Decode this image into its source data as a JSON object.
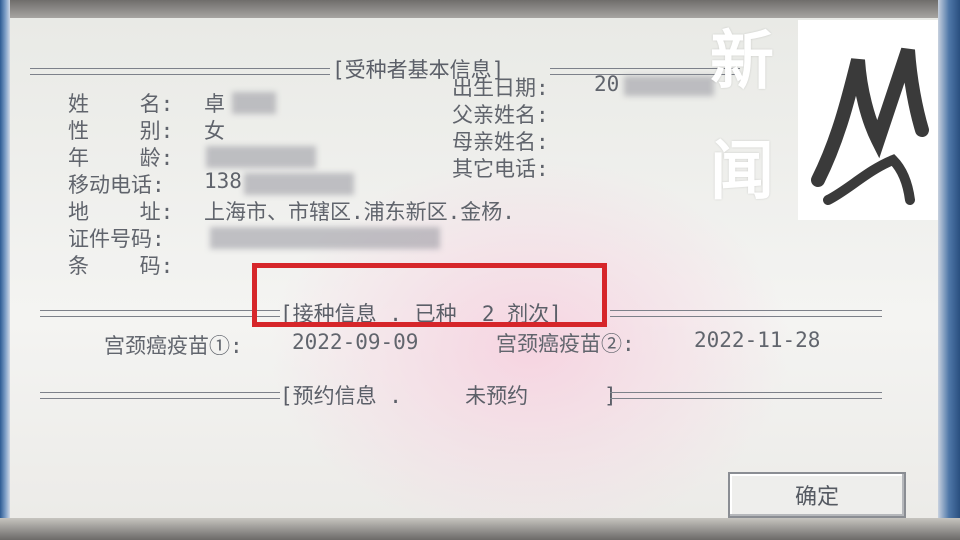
{
  "photo_frame": {
    "bezel_color": "#2c5b94"
  },
  "basic_info": {
    "header": "[受种者基本信息]",
    "name_label": "姓    名:",
    "name_value": "卓",
    "gender_label": "性    别:",
    "gender_value": "女",
    "age_label": "年    龄:",
    "age_value": "",
    "mobile_label": "移动电话:",
    "mobile_value": "138",
    "address_label": "地    址:",
    "address_value": "上海市、市辖区.浦东新区.金杨.",
    "id_label": "证件号码:",
    "id_value": "",
    "barcode_label": "条    码:",
    "barcode_value": "",
    "birth_label": "出生日期:",
    "birth_value": "20",
    "father_label": "父亲姓名:",
    "father_value": "",
    "mother_label": "母亲姓名:",
    "mother_value": "",
    "other_phone_label": "其它电话:",
    "other_phone_value": ""
  },
  "vaccination": {
    "header": "[接种信息 . 已种  2 剂次]",
    "doses": [
      {
        "label": "宫颈癌疫苗①:",
        "date": "2022-09-09"
      },
      {
        "label": "宫颈癌疫苗②:",
        "date": "2022-11-28"
      }
    ]
  },
  "appointment": {
    "header": "[预约信息 .     未预约      ]"
  },
  "buttons": {
    "confirm": "确定"
  },
  "watermark": {
    "text": "新闻",
    "logo_icon": "brush-stroke-logo"
  },
  "colors": {
    "highlight": "#d6262a",
    "window_bg": "#f1f1ef",
    "text": "#5b5f68"
  }
}
